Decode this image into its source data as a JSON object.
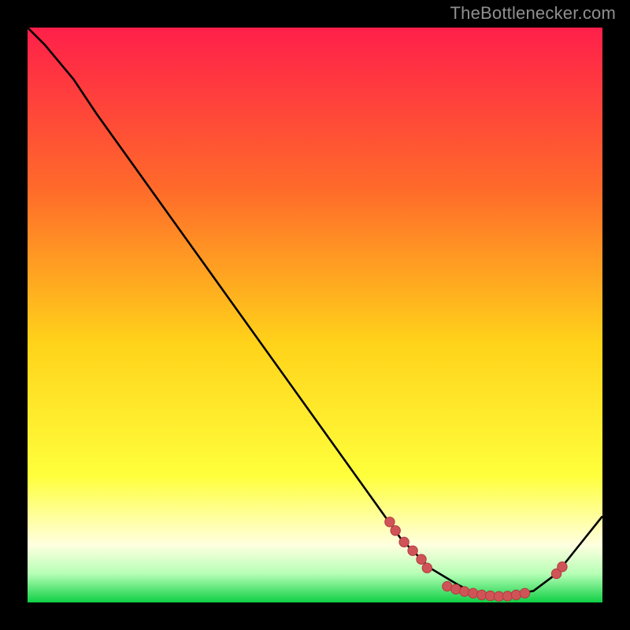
{
  "attribution": "TheBottlenecker.com",
  "colors": {
    "bg_black": "#000000",
    "grad_top": "#ff1f4a",
    "grad_mid_upper": "#ff6a2a",
    "grad_mid": "#ffd31a",
    "grad_mid_lower": "#ffff3c",
    "grad_cream": "#ffffe0",
    "grad_green_light": "#b6ffb6",
    "grad_green": "#0fcf44",
    "curve_color": "#000000",
    "marker_fill": "#cf5458",
    "marker_stroke": "#b23b3f"
  },
  "chart_data": {
    "type": "line",
    "title": "",
    "xlabel": "",
    "ylabel": "",
    "xlim": [
      0,
      100
    ],
    "ylim": [
      0,
      100
    ],
    "curve": [
      {
        "x": 0,
        "y": 100
      },
      {
        "x": 3,
        "y": 97
      },
      {
        "x": 8,
        "y": 91
      },
      {
        "x": 12,
        "y": 85
      },
      {
        "x": 60,
        "y": 18
      },
      {
        "x": 65,
        "y": 11
      },
      {
        "x": 70,
        "y": 6
      },
      {
        "x": 75,
        "y": 3
      },
      {
        "x": 78,
        "y": 1.5
      },
      {
        "x": 82,
        "y": 1
      },
      {
        "x": 88,
        "y": 2
      },
      {
        "x": 92,
        "y": 5
      },
      {
        "x": 96,
        "y": 10
      },
      {
        "x": 100,
        "y": 15
      }
    ],
    "markers_segment1": [
      {
        "x": 63,
        "y": 14
      },
      {
        "x": 64,
        "y": 12.5
      },
      {
        "x": 65.5,
        "y": 10.5
      },
      {
        "x": 67,
        "y": 9
      },
      {
        "x": 68.5,
        "y": 7.5
      },
      {
        "x": 69.5,
        "y": 6
      }
    ],
    "markers_segment2": [
      {
        "x": 73,
        "y": 2.8
      },
      {
        "x": 74.5,
        "y": 2.3
      },
      {
        "x": 76,
        "y": 1.9
      },
      {
        "x": 77.5,
        "y": 1.6
      },
      {
        "x": 79,
        "y": 1.3
      },
      {
        "x": 80.5,
        "y": 1.15
      },
      {
        "x": 82,
        "y": 1.05
      },
      {
        "x": 83.5,
        "y": 1.1
      },
      {
        "x": 85,
        "y": 1.3
      },
      {
        "x": 86.5,
        "y": 1.6
      }
    ],
    "markers_segment3": [
      {
        "x": 92,
        "y": 5
      },
      {
        "x": 93,
        "y": 6.2
      }
    ]
  }
}
